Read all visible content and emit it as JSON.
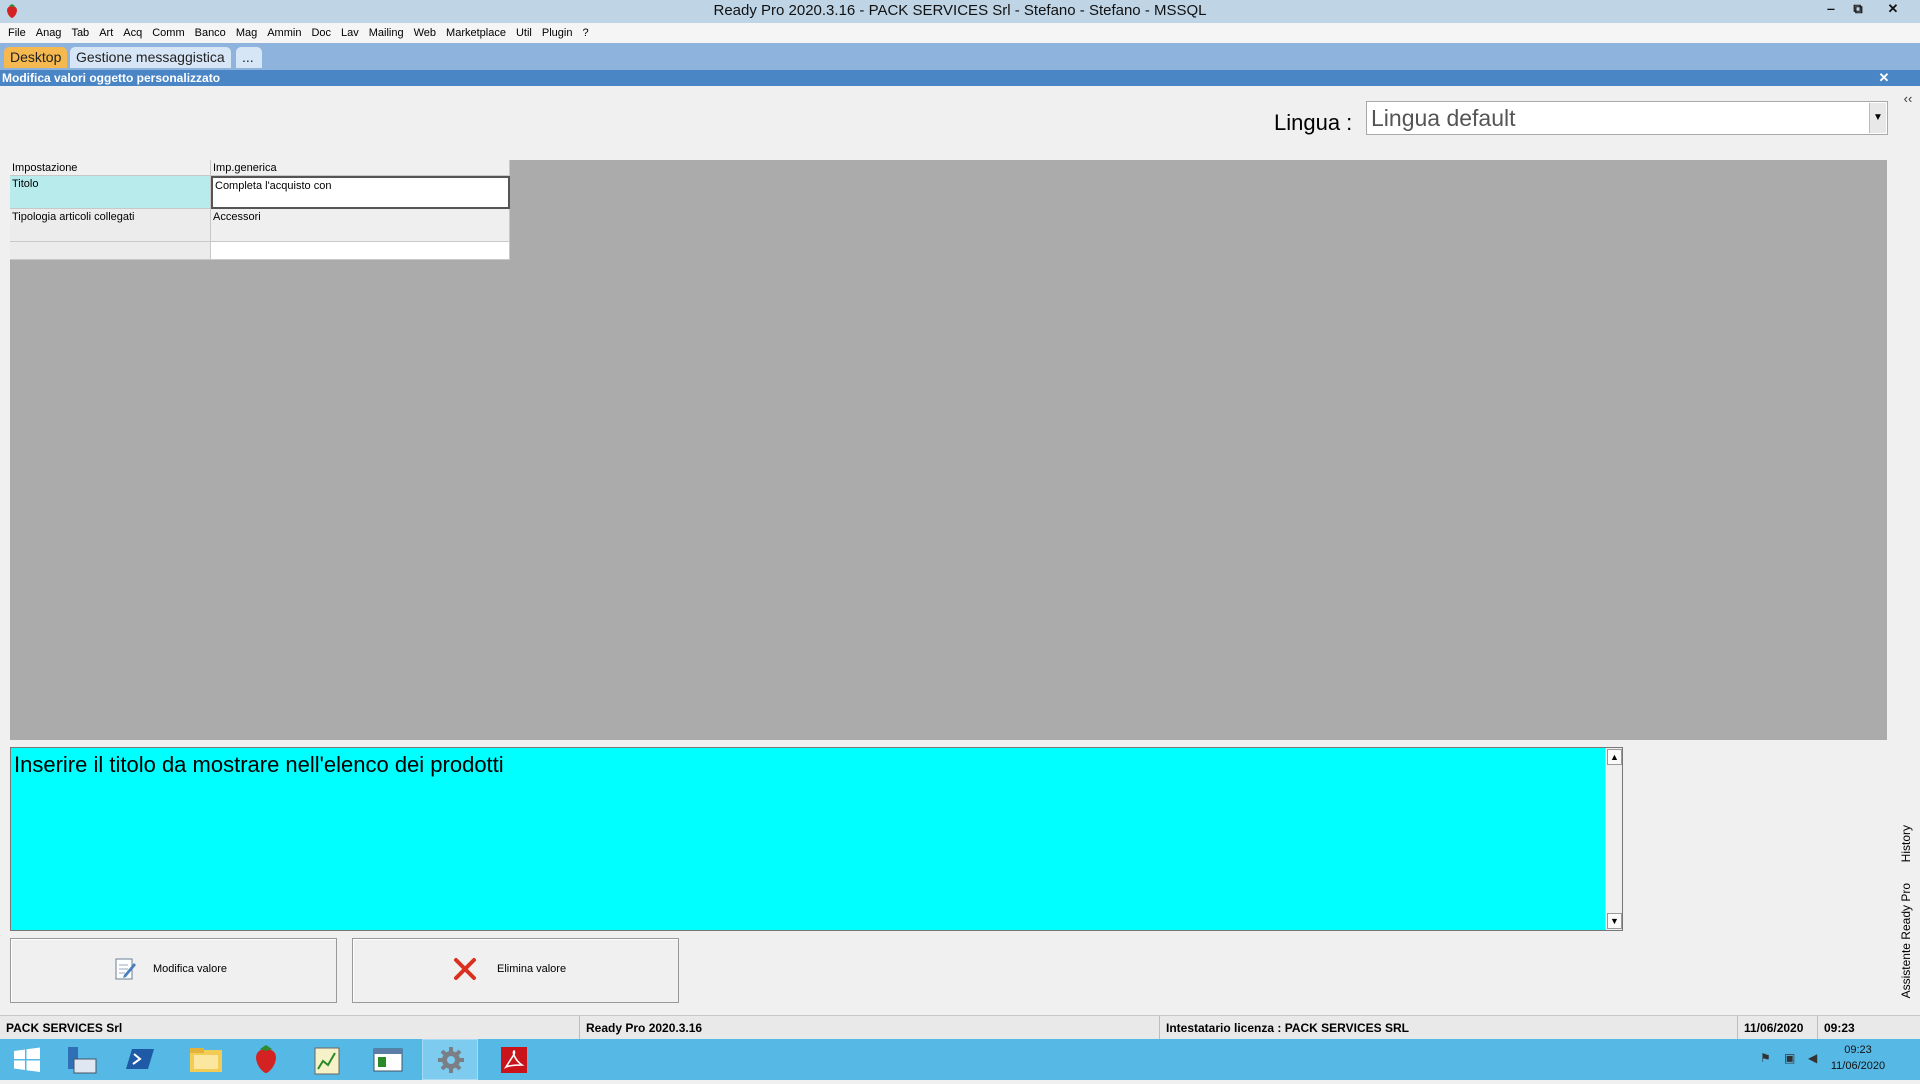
{
  "window": {
    "title": "Ready Pro 2020.3.16 - PACK SERVICES Srl - Stefano - Stefano - MSSQL",
    "minimize": "‒",
    "restore": "⧉",
    "close": "✕"
  },
  "menu": [
    "File",
    "Anag",
    "Tab",
    "Art",
    "Acq",
    "Comm",
    "Banco",
    "Mag",
    "Ammin",
    "Doc",
    "Lav",
    "Mailing",
    "Web",
    "Marketplace",
    "Util",
    "Plugin",
    "?"
  ],
  "tabs": {
    "desktop": "Desktop",
    "messaging": "Gestione messaggistica",
    "more": "..."
  },
  "subwindow": {
    "title": "Modifica valori oggetto personalizzato",
    "close": "✕",
    "collapse": "‹‹"
  },
  "lingua": {
    "label": "Lingua :",
    "value": "Lingua default"
  },
  "grid": {
    "headers": [
      "Impostazione",
      "Imp.generica"
    ],
    "rows": [
      {
        "key": "Titolo",
        "value": "Completa l'acquisto con"
      },
      {
        "key": "Tipologia articoli collegati",
        "value": "Accessori"
      }
    ]
  },
  "description": "Inserire il titolo da mostrare nell'elenco dei prodotti",
  "buttons": {
    "edit": "Modifica valore",
    "delete": "Elimina valore"
  },
  "side_tabs": {
    "history": "History",
    "assistant": "Assistente Ready Pro"
  },
  "statusbar": {
    "company": "PACK SERVICES Srl",
    "version": "Ready Pro 2020.3.16",
    "license": "Intestatario licenza : PACK SERVICES SRL",
    "date": "11/06/2020",
    "time": "09:23"
  },
  "taskbar": {
    "clock_time": "09:23",
    "clock_date": "11/06/2020"
  },
  "colors": {
    "accent_tab": "#f6b94f",
    "description_bg": "#00ffff",
    "selected_cell": "#b8ecec",
    "taskbar": "#56b8e4"
  }
}
